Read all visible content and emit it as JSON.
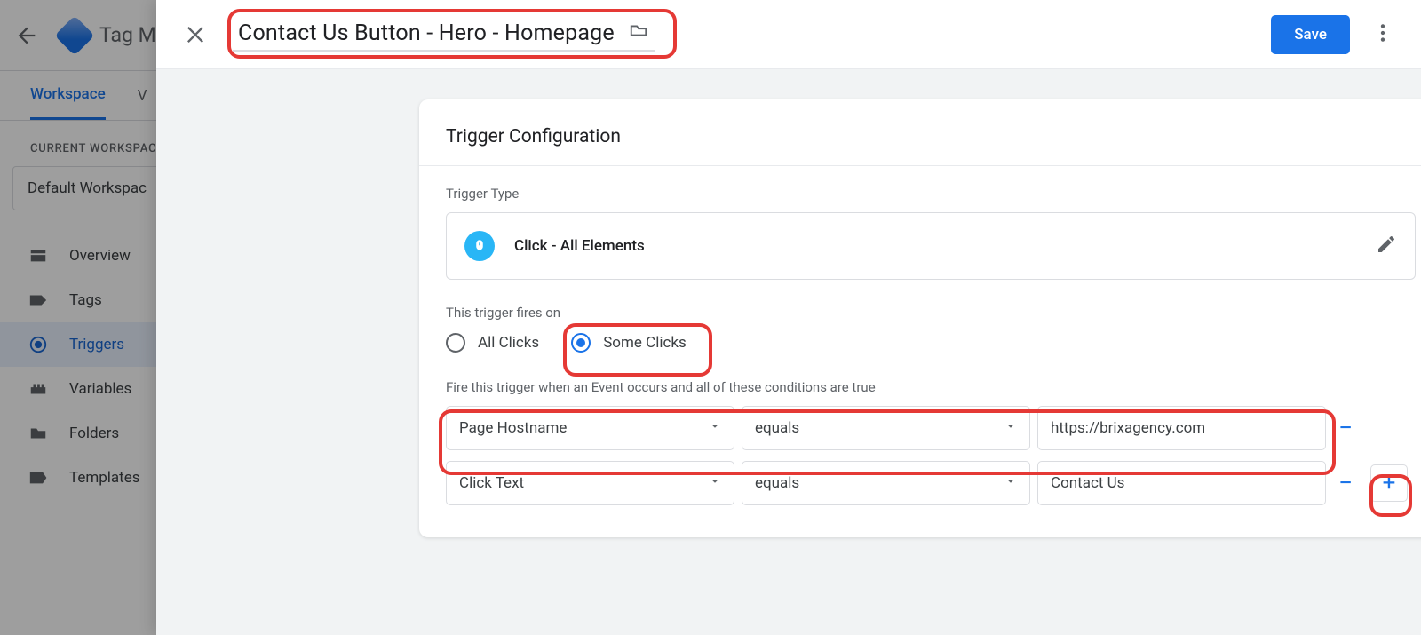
{
  "app": {
    "title_truncated": "Tag M",
    "tabs": {
      "workspace": "Workspace",
      "versions_initial": "V"
    },
    "workspace_label": "CURRENT WORKSPACE",
    "workspace_name": "Default Workspac",
    "nav": {
      "overview": "Overview",
      "tags": "Tags",
      "triggers": "Triggers",
      "variables": "Variables",
      "folders": "Folders",
      "templates": "Templates"
    }
  },
  "modal": {
    "title": "Contact Us Button - Hero - Homepage",
    "save_label": "Save",
    "card": {
      "heading": "Trigger Configuration",
      "type_label": "Trigger Type",
      "type_value": "Click - All Elements",
      "fires_on_label": "This trigger fires on",
      "radio_all": "All Clicks",
      "radio_some": "Some Clicks",
      "cond_intro": "Fire this trigger when an Event occurs and all of these conditions are true",
      "rows": [
        {
          "var": "Page Hostname",
          "op": "equals",
          "val": "https://brixagency.com"
        },
        {
          "var": "Click Text",
          "op": "equals",
          "val": "Contact Us"
        }
      ]
    }
  }
}
